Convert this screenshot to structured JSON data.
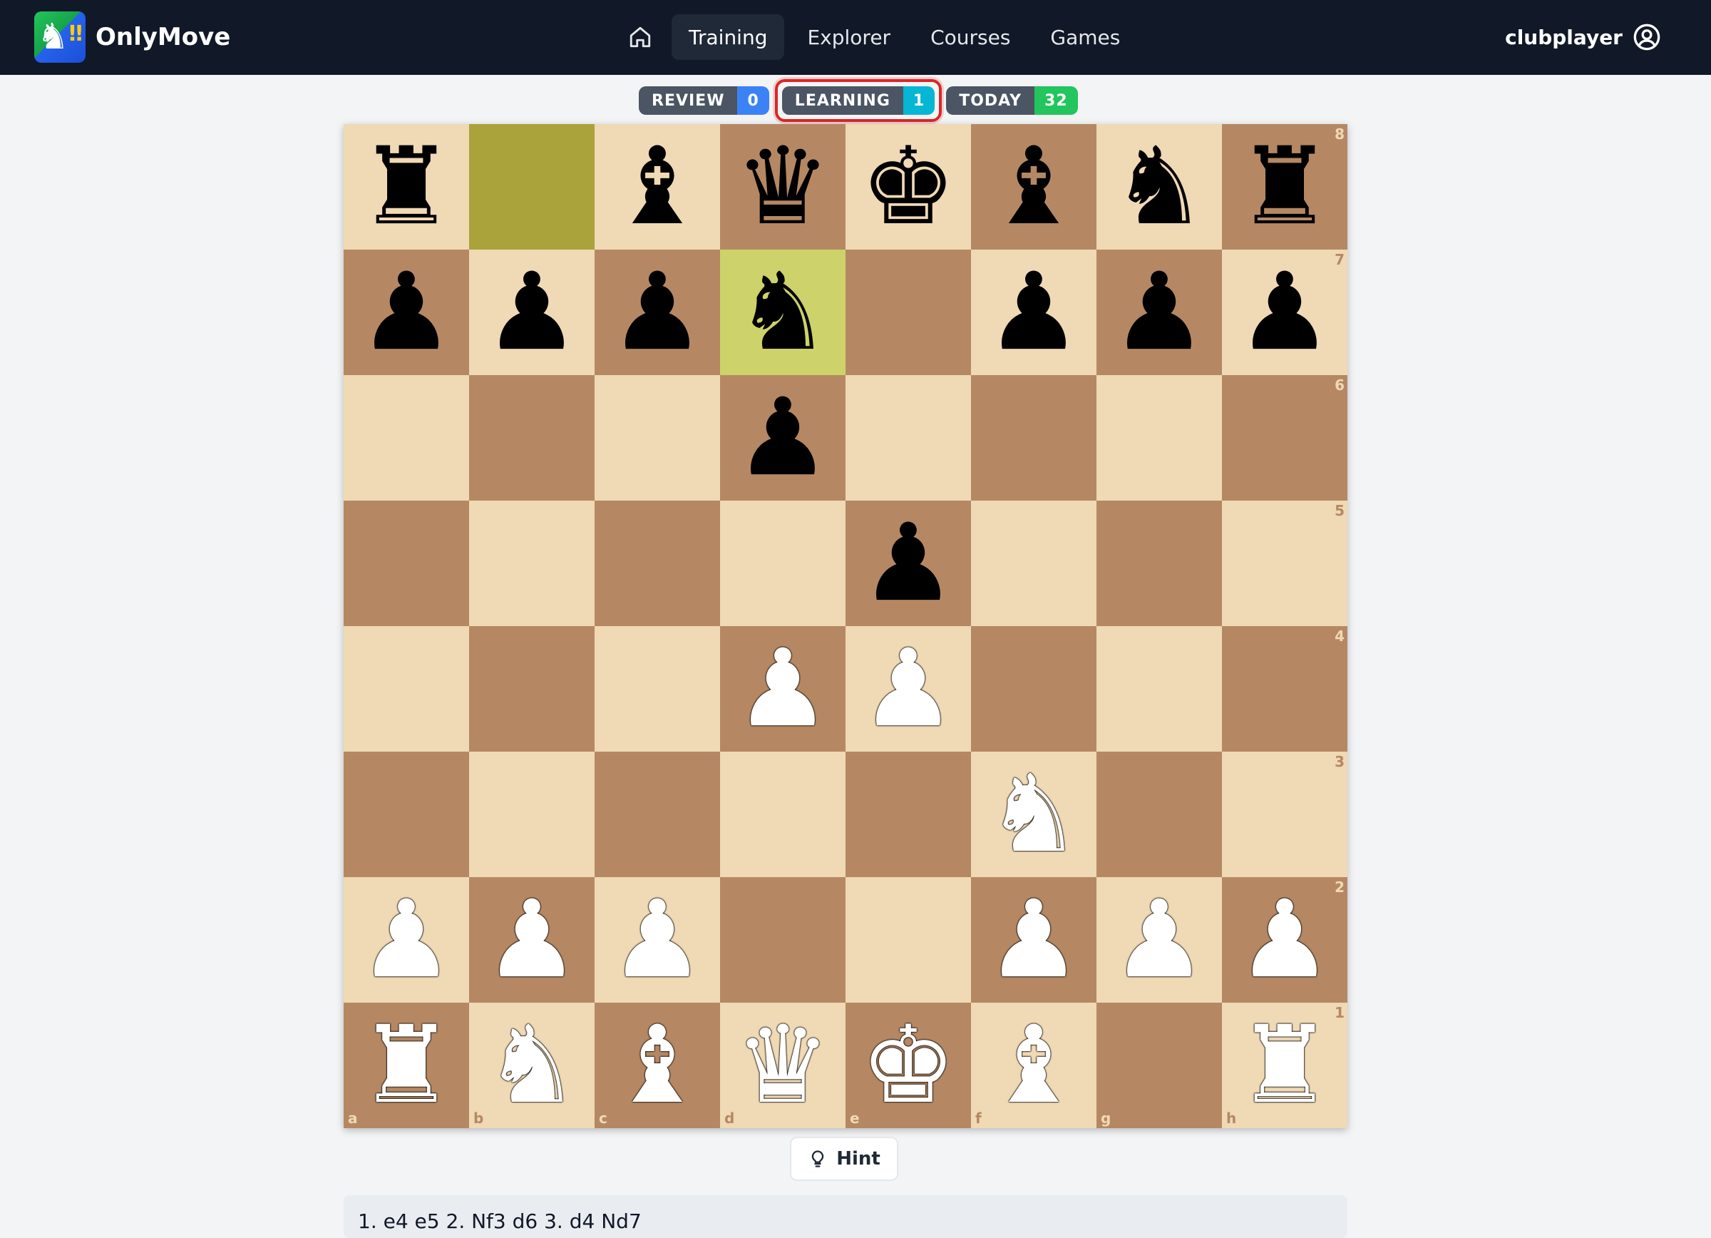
{
  "app": {
    "name": "OnlyMove"
  },
  "nav": {
    "home_icon": "home-icon",
    "items": [
      {
        "label": "Training",
        "active": true
      },
      {
        "label": "Explorer",
        "active": false
      },
      {
        "label": "Courses",
        "active": false
      },
      {
        "label": "Games",
        "active": false
      }
    ]
  },
  "user": {
    "name": "clubplayer",
    "icon": "user-circle-icon"
  },
  "counters": [
    {
      "label": "REVIEW",
      "count": "0",
      "color": "#3b82f6"
    },
    {
      "label": "LEARNING",
      "count": "1",
      "color": "#06b6d4",
      "highlighted": true
    },
    {
      "label": "TODAY",
      "count": "32",
      "color": "#22c55e"
    }
  ],
  "board": {
    "files": [
      "a",
      "b",
      "c",
      "d",
      "e",
      "f",
      "g",
      "h"
    ],
    "ranks": [
      "8",
      "7",
      "6",
      "5",
      "4",
      "3",
      "2",
      "1"
    ],
    "orientation": "white",
    "last_move": {
      "from": "b8",
      "to": "d7"
    },
    "pieces": {
      "a8": "bR",
      "c8": "bB",
      "d8": "bQ",
      "e8": "bK",
      "f8": "bB",
      "g8": "bN",
      "h8": "bR",
      "a7": "bP",
      "b7": "bP",
      "c7": "bP",
      "d7": "bN",
      "f7": "bP",
      "g7": "bP",
      "h7": "bP",
      "d6": "bP",
      "e5": "bP",
      "d4": "wP",
      "e4": "wP",
      "f3": "wN",
      "a2": "wP",
      "b2": "wP",
      "c2": "wP",
      "f2": "wP",
      "g2": "wP",
      "h2": "wP",
      "a1": "wR",
      "b1": "wN",
      "c1": "wB",
      "d1": "wQ",
      "e1": "wK",
      "f1": "wB",
      "h1": "wR"
    },
    "colors": {
      "light": "#f0d9b5",
      "dark": "#b58863",
      "last_from": "#aaa23a",
      "last_to": "#cdd26a"
    }
  },
  "hint": {
    "label": "Hint",
    "icon": "lightbulb-icon"
  },
  "moves": {
    "text": "1. e4 e5 2. Nf3 d6 3. d4 Nd7"
  }
}
